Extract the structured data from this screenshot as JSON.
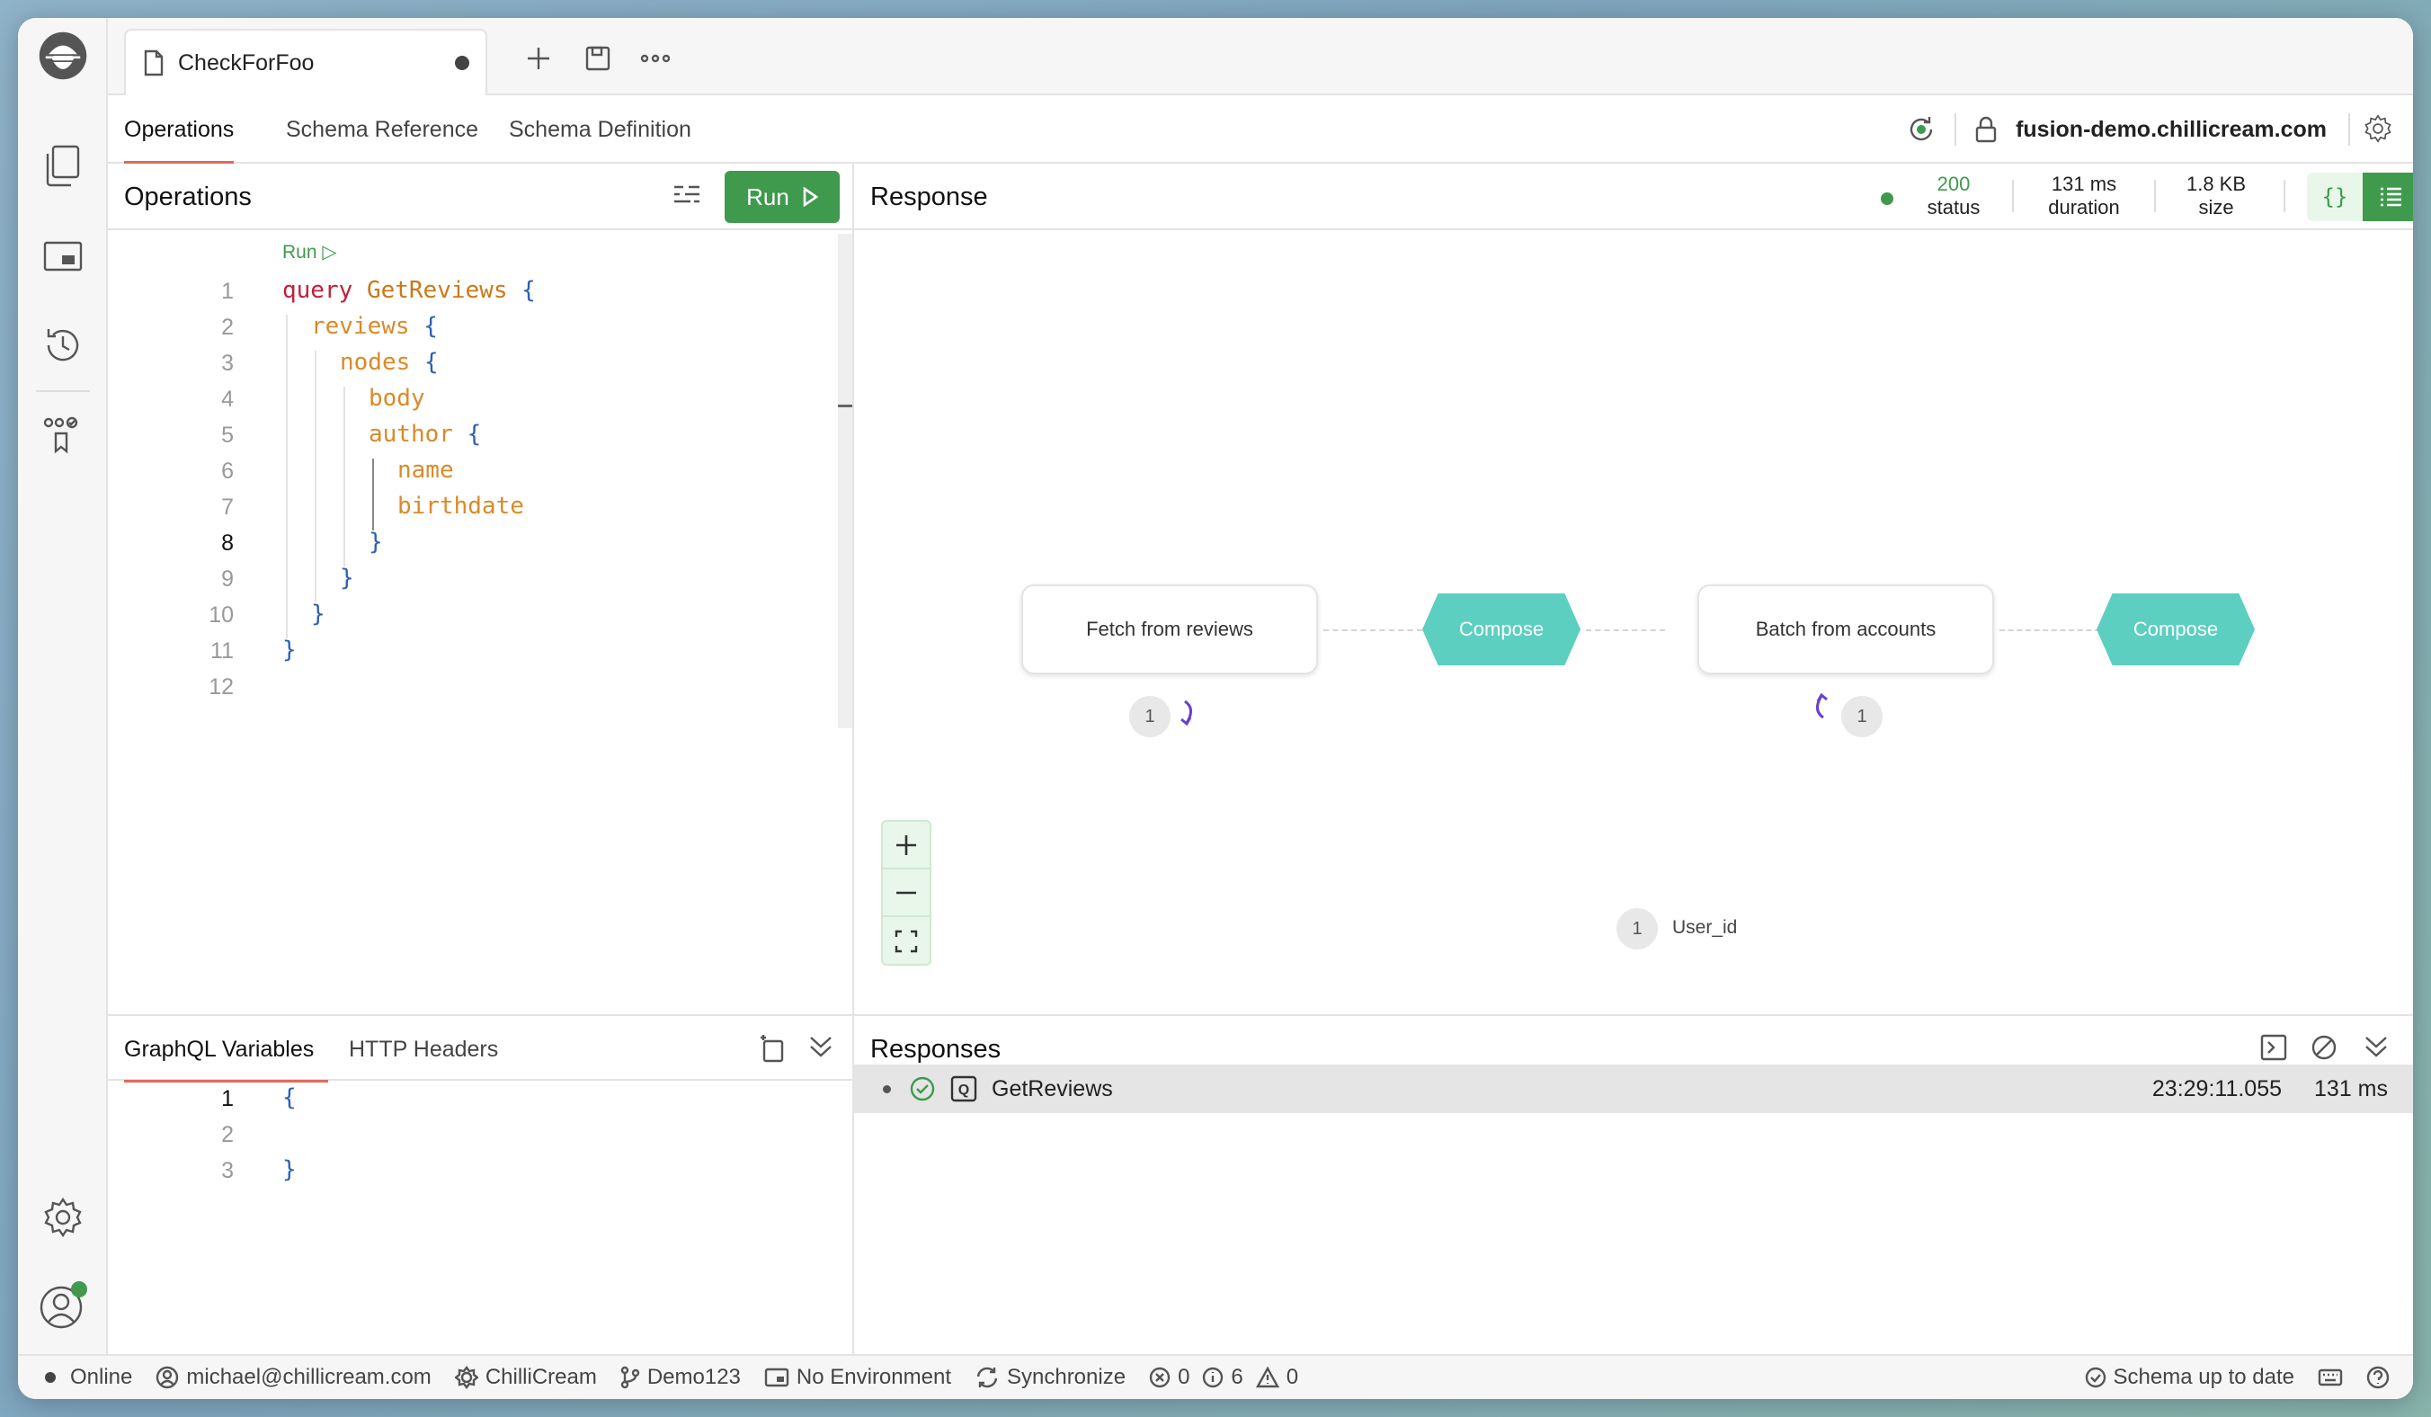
{
  "document": {
    "tab_title": "CheckForFoo"
  },
  "subnav": {
    "tabs": [
      "Operations",
      "Schema Reference",
      "Schema Definition"
    ],
    "endpoint": "fusion-demo.chillicream.com"
  },
  "operations": {
    "title": "Operations",
    "run_label": "Run",
    "codelens": "Run ▷",
    "line_numbers": [
      "1",
      "2",
      "3",
      "4",
      "5",
      "6",
      "7",
      "8",
      "9",
      "10",
      "11",
      "12"
    ],
    "code": {
      "l1_kw": "query",
      "l1_name": "GetReviews",
      "l1_brace": "{",
      "l2_field": "reviews",
      "l2_brace": "{",
      "l3_field": "nodes",
      "l3_brace": "{",
      "l4_field": "body",
      "l5_field": "author",
      "l5_brace": "{",
      "l6_field": "name",
      "l7_field": "birthdate",
      "l8": "}",
      "l9": "}",
      "l10": "}",
      "l11": "}"
    }
  },
  "response": {
    "title": "Response",
    "status_value": "200",
    "status_label": "status",
    "duration_value": "131 ms",
    "duration_label": "duration",
    "size_value": "1.8 KB",
    "size_label": "size",
    "plan": {
      "node1": "Fetch from reviews",
      "compose1": "Compose",
      "node2": "Batch from accounts",
      "compose2": "Compose",
      "badge1": "1",
      "badge2": "1",
      "badge3": "1",
      "var_label": "User_id"
    }
  },
  "variables": {
    "tabs": [
      "GraphQL Variables",
      "HTTP Headers"
    ],
    "line_numbers": [
      "1",
      "2",
      "3"
    ],
    "open": "{",
    "close": "}"
  },
  "responses": {
    "title": "Responses",
    "rows": [
      {
        "name": "GetReviews",
        "time": "23:29:11.055",
        "duration": "131 ms"
      }
    ]
  },
  "statusbar": {
    "online": "Online",
    "user": "michael@chillicream.com",
    "org": "ChilliCream",
    "workspace": "Demo123",
    "environment": "No Environment",
    "sync": "Synchronize",
    "errors": "0",
    "infos": "6",
    "warnings": "0",
    "schema": "Schema up to date"
  },
  "colors": {
    "accent_green": "#3f9a4d",
    "compose_teal": "#5ccfc0",
    "active_tab_underline": "#e06a5a"
  }
}
